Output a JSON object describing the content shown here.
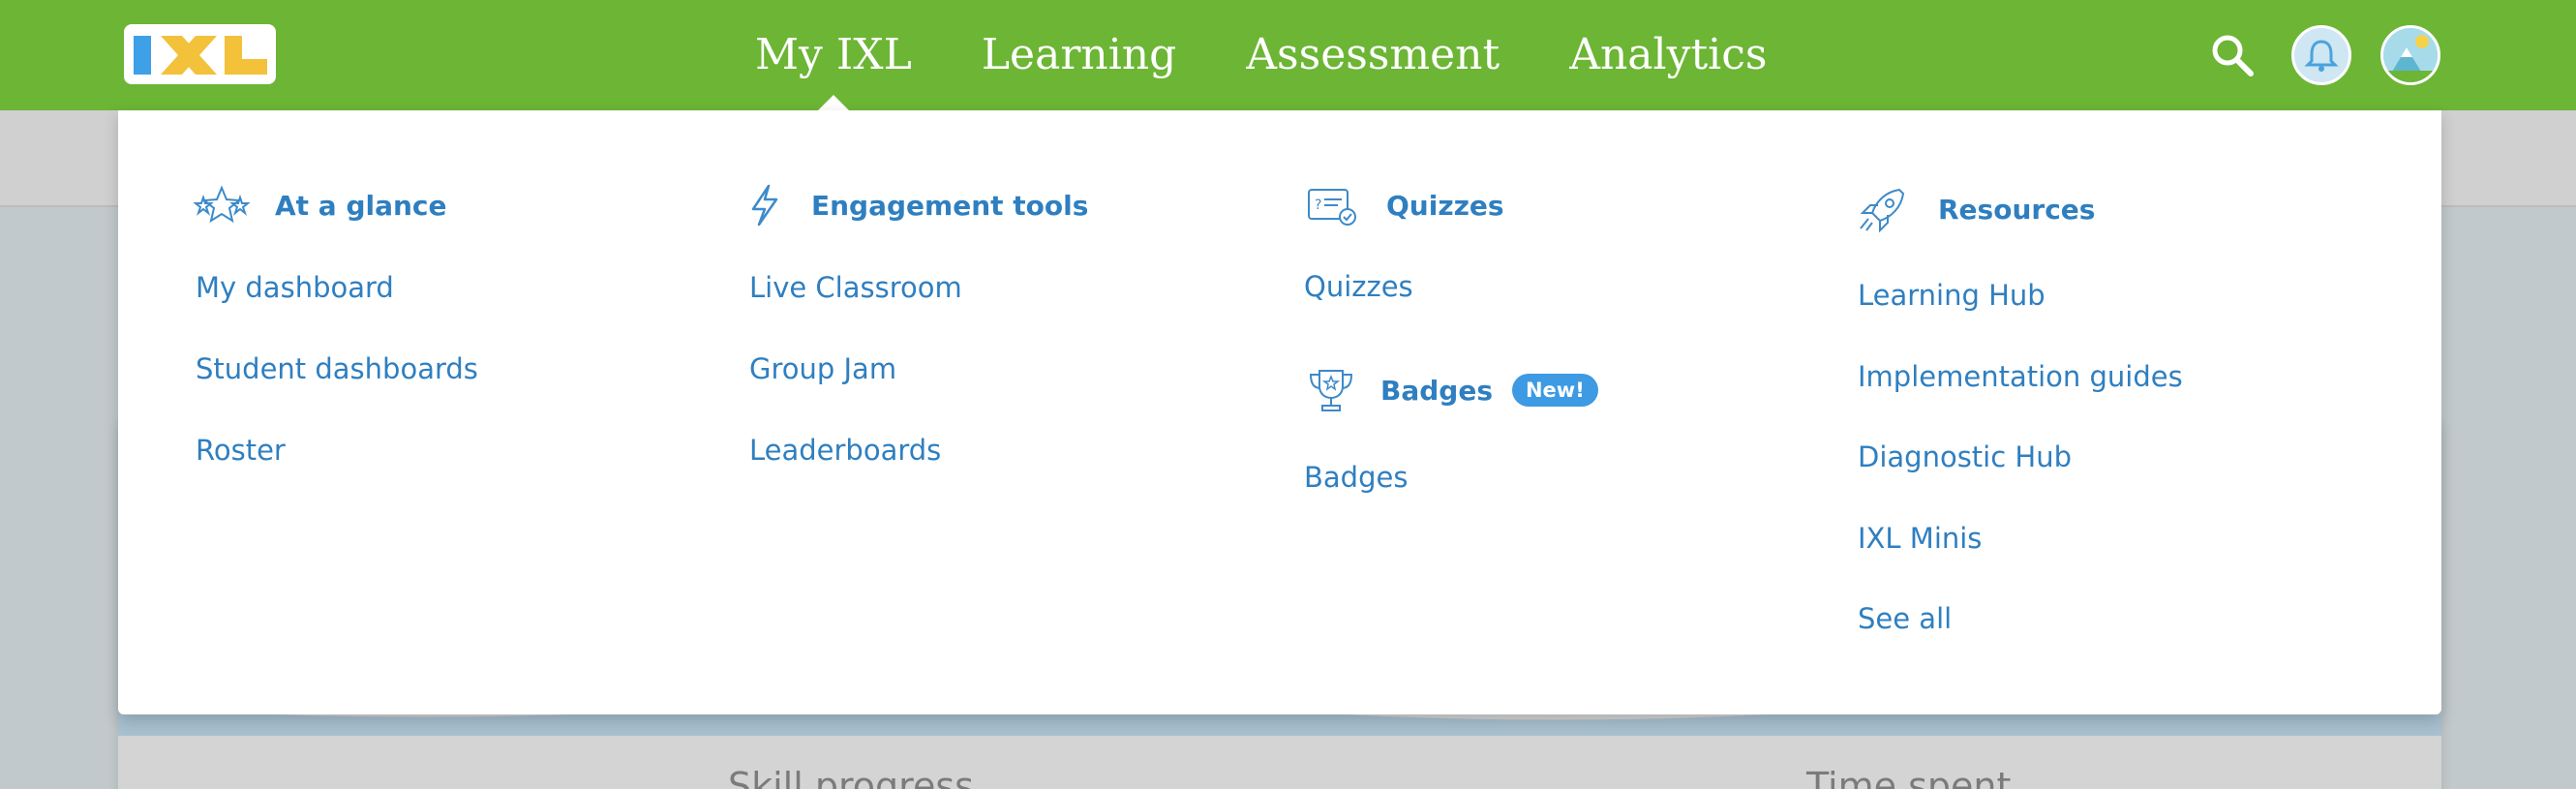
{
  "header": {
    "logo_text": "IXL",
    "nav": [
      {
        "label": "My IXL",
        "active": true
      },
      {
        "label": "Learning",
        "active": false
      },
      {
        "label": "Assessment",
        "active": false
      },
      {
        "label": "Analytics",
        "active": false
      }
    ],
    "icons": [
      "search-icon",
      "notifications-bell-icon",
      "user-avatar-icon"
    ]
  },
  "menu": {
    "columns": [
      {
        "title": "At a glance",
        "icon": "stars-icon",
        "links": [
          "My dashboard",
          "Student dashboards",
          "Roster"
        ]
      },
      {
        "title": "Engagement tools",
        "icon": "lightning-icon",
        "links": [
          "Live Classroom",
          "Group Jam",
          "Leaderboards"
        ]
      },
      {
        "title": "Quizzes",
        "icon": "quiz-icon",
        "links": [
          "Quizzes"
        ],
        "second_title": "Badges",
        "second_icon": "trophy-icon",
        "second_badge": "New!",
        "second_links": [
          "Badges"
        ]
      },
      {
        "title": "Resources",
        "icon": "rocket-icon",
        "links": [
          "Learning Hub",
          "Implementation guides",
          "Diagnostic Hub",
          "IXL Minis",
          "See all"
        ]
      }
    ]
  },
  "background": {
    "labels": [
      "Skill progress",
      "Time spent"
    ]
  },
  "colors": {
    "brand_green": "#6cb535",
    "link_blue": "#2f7fc0",
    "badge_blue": "#3d9ae3"
  }
}
